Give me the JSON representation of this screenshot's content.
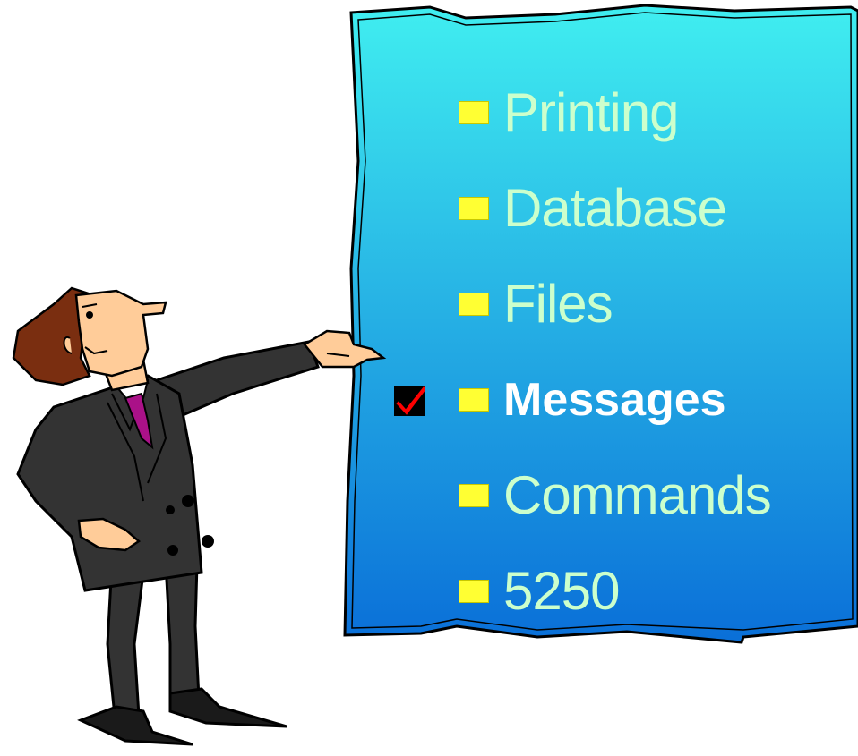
{
  "colors": {
    "board_top": "#40eef0",
    "board_bottom": "#0a6fd8",
    "bullet": "#ffff33",
    "item_text": "#ccffcc",
    "active_text": "#ffffff",
    "check_mark": "#ff0000"
  },
  "menu": {
    "items": [
      {
        "label": "Printing",
        "active": false
      },
      {
        "label": "Database",
        "active": false
      },
      {
        "label": "Files",
        "active": false
      },
      {
        "label": "Messages",
        "active": true
      },
      {
        "label": "Commands",
        "active": false
      },
      {
        "label": "5250",
        "active": false
      }
    ],
    "selected_icon": "checkmark-icon"
  },
  "figure": {
    "icon": "businessman-pointing-icon"
  }
}
